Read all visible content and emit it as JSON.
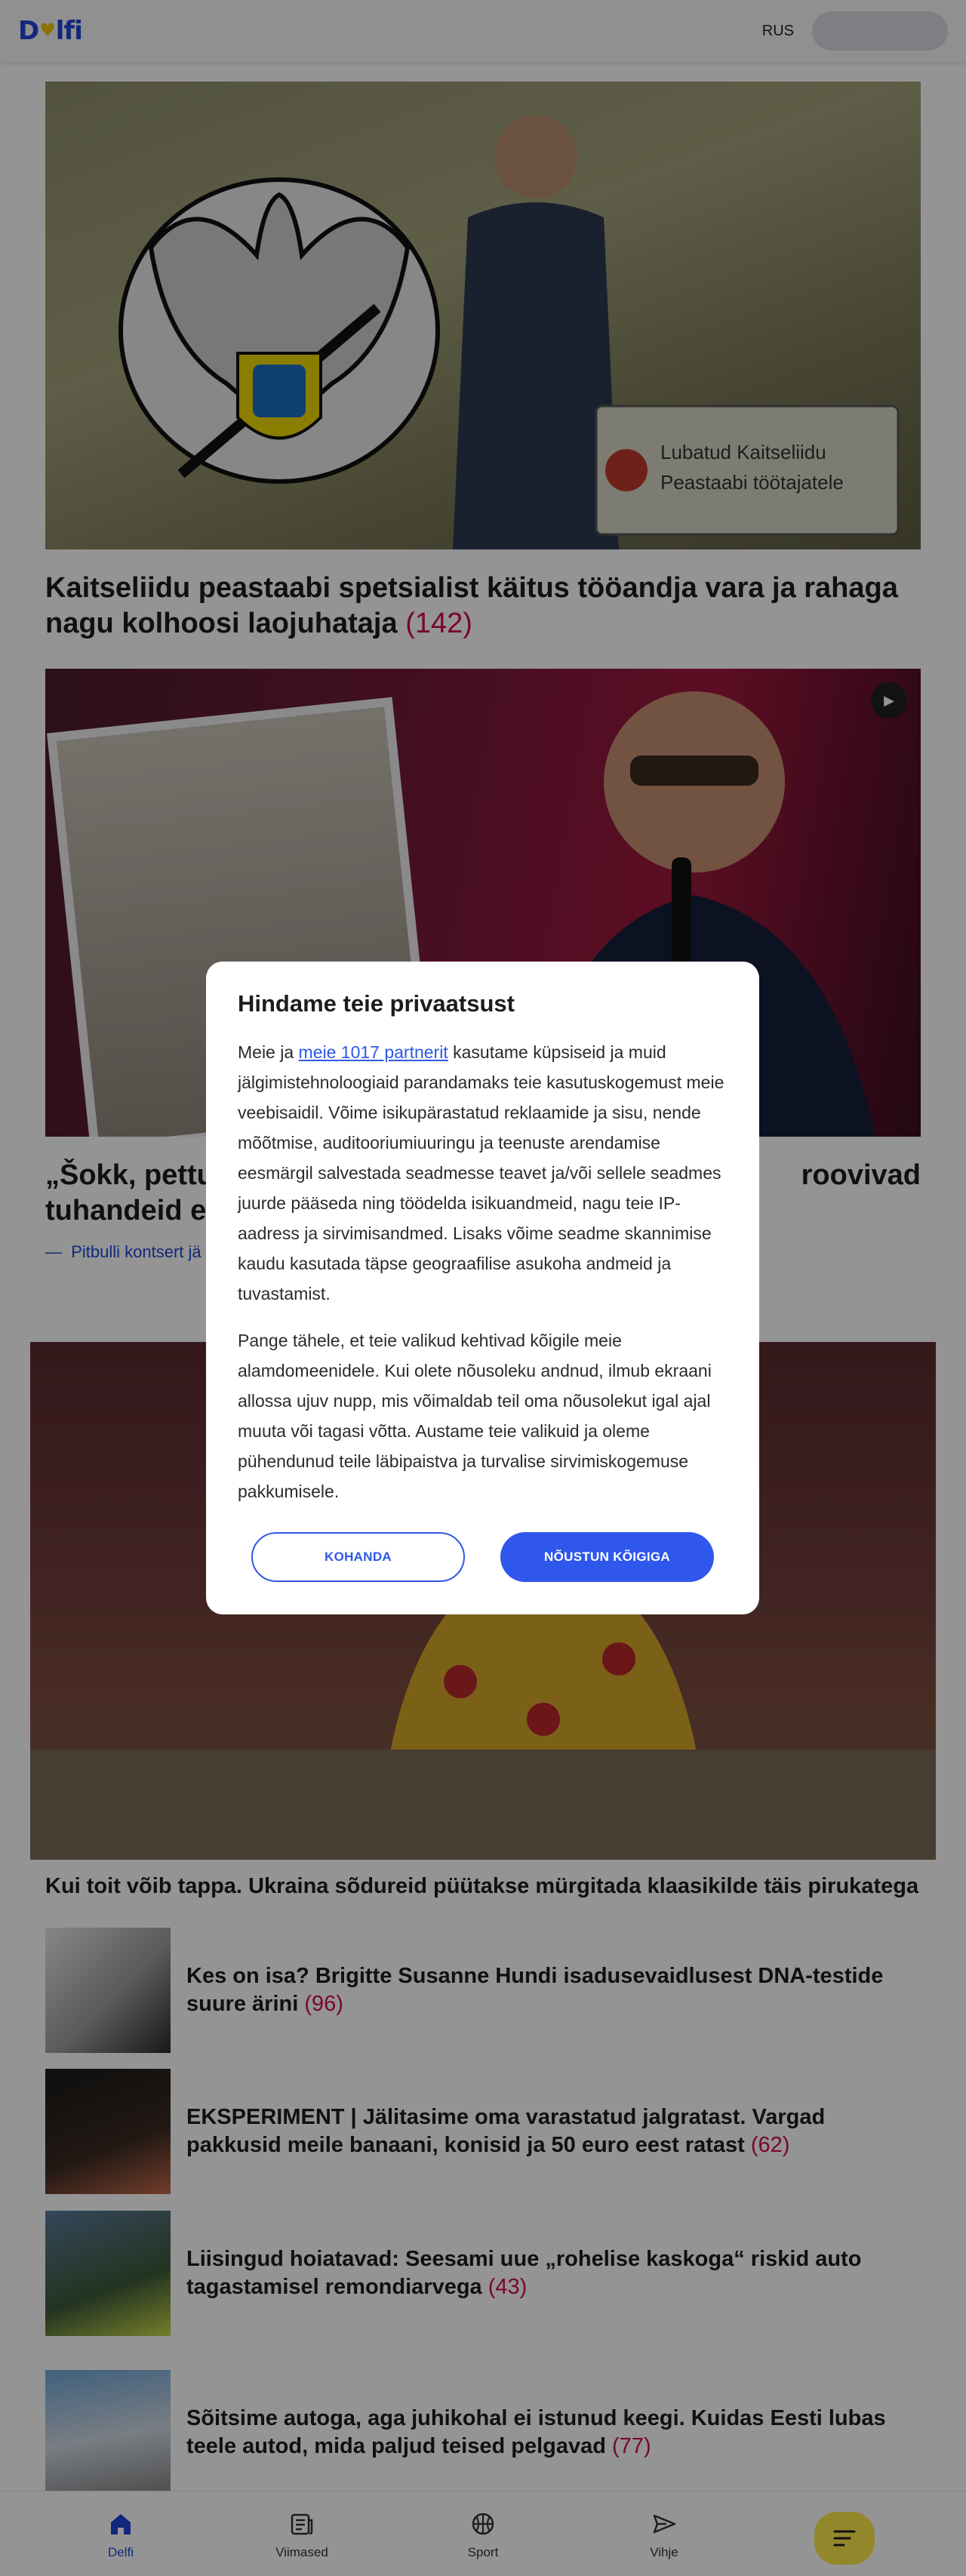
{
  "header": {
    "logo_text": "Delfi",
    "lang_label": "RUS"
  },
  "articles": {
    "a1": {
      "title": "Kaitseliidu peastaabi spetsialist käitus tööandja vara ja rahaga nagu kolhoosi laojuhataja",
      "comments": "(142)",
      "sign_line1": "Lubatud Kaitseliidu",
      "sign_line2": "Peastaabi töötajatele"
    },
    "a2": {
      "title_visible_start": "„Šokk, pettu",
      "title_visible_end": "roovivad",
      "title_line2": "tuhandeid e",
      "related": "Pitbulli kontsert jä"
    },
    "a3": {
      "title": "Kui toit võib tappa. Ukraina sõdureid püütakse mürgitada klaasikilde täis pirukatega"
    },
    "list": [
      {
        "title": "Kes on isa? Brigitte Susanne Hundi isadusevaidlusest DNA-testide suure ärini",
        "comments": "(96)"
      },
      {
        "title": "EKSPERIMENT | Jälitasime oma varastatud jalgratast. Vargad pakkusid meile banaani, konisid ja 50 euro eest ratast",
        "comments": "(62)"
      },
      {
        "title": "Liisingud hoiatavad: Seesami uue „rohelise kaskoga“ riskid auto tagastamisel remondiarvega",
        "comments": "(43)"
      },
      {
        "title": "Sõitsime autoga, aga juhikohal ei istunud keegi. Kuidas Eesti lubas teele autod, mida paljud teised pelgavad",
        "comments": "(77)"
      }
    ]
  },
  "consent": {
    "title": "Hindame teie privaatsust",
    "p1_before": "Meie ja ",
    "p1_link": "meie 1017 partnerit",
    "p1_after": " kasutame küpsiseid ja muid jälgimistehnoloogiaid parandamaks teie kasutuskogemust meie veebisaidil. Võime isikupärastatud reklaamide ja sisu, nende mõõtmise, auditooriumiuuringu ja teenuste arendamise eesmärgil salvestada seadmesse teavet ja/või sellele seadmes juurde pääseda ning töödelda isikuandmeid, nagu teie IP-aadress ja sirvimisandmed. Lisaks võime seadme skannimise kaudu kasutada täpse geograafilise asukoha andmeid ja tuvastamist.",
    "p2": "Pange tähele, et teie valikud kehtivad kõigile meie alamdomeenidele. Kui olete nõusoleku andnud, ilmub ekraani allossa ujuv nupp, mis võimaldab teil oma nõusolekut igal ajal muuta või tagasi võtta. Austame teie valikuid ja oleme pühendunud teile läbipaistva ja turvalise sirvimiskogemuse pakkumisele.",
    "customize_label": "KOHANDA",
    "accept_label": "NÕUSTUN KÕIGIGA"
  },
  "bottom_nav": [
    {
      "label": "Delfi",
      "icon": "home-icon",
      "active": true
    },
    {
      "label": "Viimased",
      "icon": "newspaper-icon",
      "active": false
    },
    {
      "label": "Sport",
      "icon": "basketball-icon",
      "active": false
    },
    {
      "label": "Vihje",
      "icon": "send-icon",
      "active": false
    }
  ],
  "colors": {
    "brand_blue": "#1f45d6",
    "comment_red": "#d10b45",
    "menu_yellow": "#fbe94a",
    "accept_blue": "#2f57ec"
  }
}
